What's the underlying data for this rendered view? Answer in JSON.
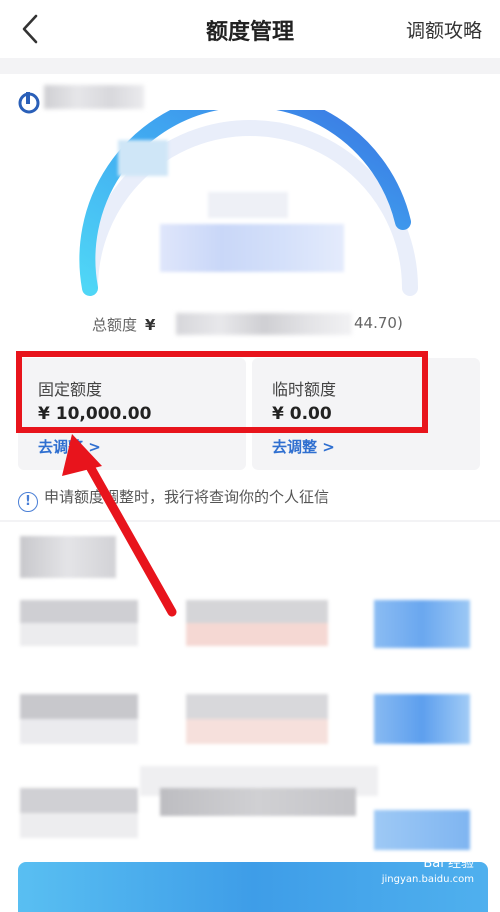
{
  "nav": {
    "title": "额度管理",
    "right_link": "调额攻略"
  },
  "account": {
    "total_label": "总额度",
    "total_currency": "¥",
    "total_value_visible_tail": "44.70)"
  },
  "quota": {
    "fixed": {
      "label": "固定额度",
      "value": "¥ 10,000.00",
      "link": "去调整 >"
    },
    "temp": {
      "label": "临时额度",
      "value": "¥ 0.00",
      "link": "去调整 >"
    }
  },
  "notice": {
    "text": "申请额度调整时，我行将查询你的个人征信",
    "icon": "info-icon"
  },
  "watermark": {
    "brand": "Bai 经验",
    "url": "jingyan.baidu.com"
  },
  "colors": {
    "accent_blue": "#2f6fd0",
    "highlight_red": "#e8141c",
    "gauge_start": "#5fd0f5",
    "gauge_end": "#3a6fe0"
  }
}
